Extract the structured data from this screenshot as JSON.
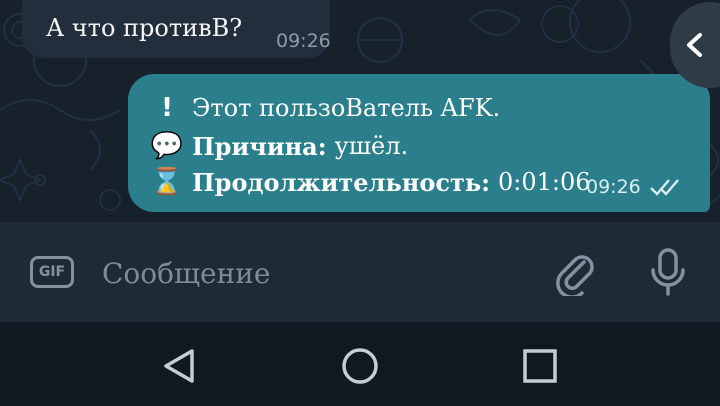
{
  "incoming_message": {
    "text": "А что противВ?",
    "time": "09:26"
  },
  "outgoing_message": {
    "lines": [
      {
        "emoji": "!",
        "icon": "exclamation-icon",
        "label": "",
        "value": "Этот пользоВатель AFK."
      },
      {
        "emoji": "💬",
        "icon": "speech-bubble-icon",
        "label": "Причина:",
        "value": "ушёл."
      },
      {
        "emoji": "⌛",
        "icon": "hourglass-icon",
        "label": "Продолжительность:",
        "value": "0:01:06"
      }
    ],
    "time": "09:26",
    "status": "read"
  },
  "input_bar": {
    "gif_label": "GIF",
    "placeholder": "Сообщение"
  },
  "colors": {
    "chat_background": "#17212b",
    "incoming_bubble": "#232e3c",
    "outgoing_bubble": "#2b7f8c",
    "input_bar": "#1e2a36",
    "nav_bar": "#0f1922"
  }
}
